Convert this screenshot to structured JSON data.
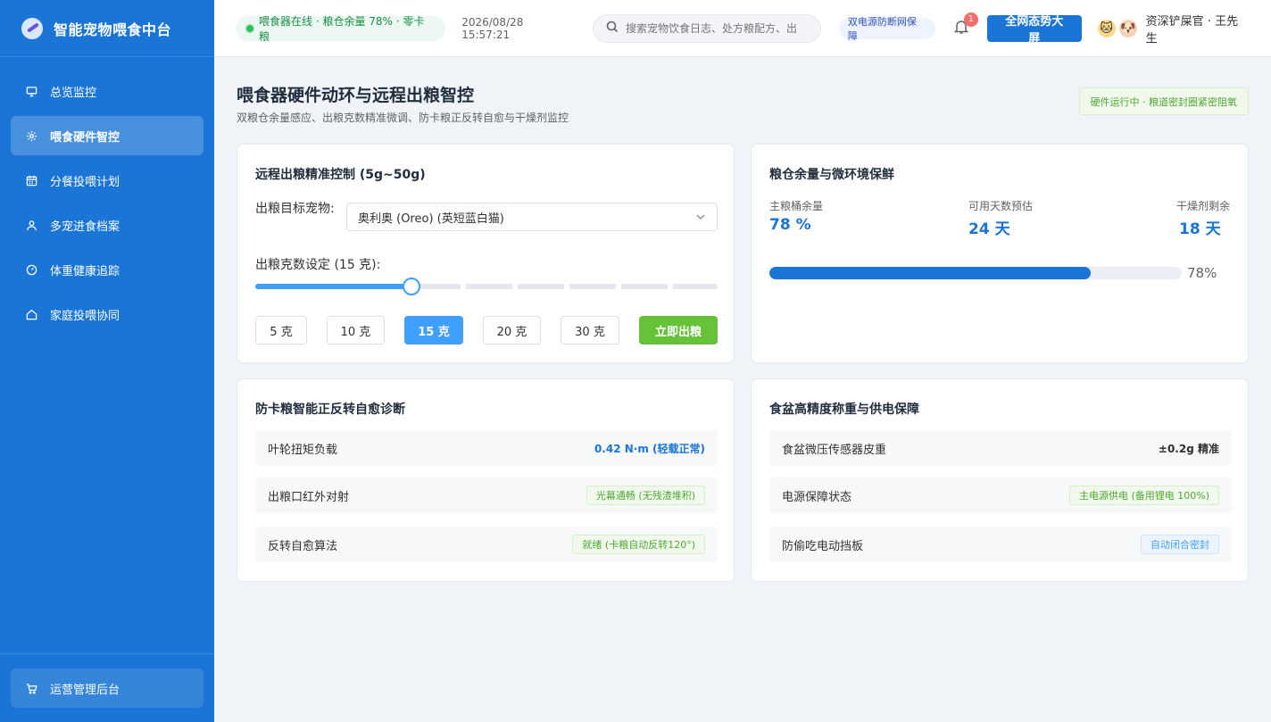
{
  "sidebar": {
    "brand": "智能宠物喂食中台",
    "items": [
      {
        "label": "总览监控",
        "icon": "monitor-icon"
      },
      {
        "label": "喂食硬件智控",
        "icon": "gear-icon",
        "active": true
      },
      {
        "label": "分餐投喂计划",
        "icon": "calendar-icon"
      },
      {
        "label": "多宠进食档案",
        "icon": "user-icon"
      },
      {
        "label": "体重健康追踪",
        "icon": "gauge-icon"
      },
      {
        "label": "家庭投喂协同",
        "icon": "home-icon"
      }
    ],
    "bottom_item": {
      "label": "运营管理后台",
      "icon": "cart-icon"
    }
  },
  "header": {
    "status": "喂食器在线 · 粮仓余量 78% · 零卡粮",
    "datetime": "2026/08/28 15:57:21",
    "search_placeholder": "搜索宠物饮食日志、处方粮配方、出",
    "power_tag": "双电源防断网保障",
    "notification_count": "1",
    "big_screen_button": "全网态势大屏",
    "user_name": "资深铲屎官 · 王先生",
    "avatar_cat": "🐱",
    "avatar_dog": "🐶"
  },
  "page": {
    "title": "喂食器硬件动环与远程出粮智控",
    "subtitle": "双粮仓余量感应、出粮克数精准微调、防卡粮正反转自愈与干燥剂监控",
    "run_tag": "硬件运行中 · 粮道密封圈紧密阻氧"
  },
  "dispense": {
    "title": "远程出粮精准控制 (5g~50g)",
    "pet_label": "出粮目标宠物:",
    "pet_selected": "奥利奥 (Oreo) (英短蓝白猫)",
    "gram_label": "出粮克数设定 (15 克):",
    "slider": {
      "min": 5,
      "max": 50,
      "value": 15
    },
    "presets": [
      "5 克",
      "10 克",
      "15 克",
      "20 克",
      "30 克"
    ],
    "active_preset": 2,
    "dispense_button": "立即出粮"
  },
  "storage": {
    "title": "粮仓余量与微环境保鲜",
    "stats": [
      {
        "label": "主粮桶余量",
        "value": "78 %"
      },
      {
        "label": "可用天数预估",
        "value": "24 天"
      },
      {
        "label": "干燥剂剩余",
        "value": "18 天"
      }
    ],
    "progress_percent": 78,
    "progress_text": "78%"
  },
  "anti_jam": {
    "title": "防卡粮智能正反转自愈诊断",
    "rows": [
      {
        "label": "叶轮扭矩负载",
        "value": "0.42 N·m (轻载正常)"
      },
      {
        "label": "出粮口红外对射",
        "value": "光幕通畅 (无残渣堆积)"
      },
      {
        "label": "反转自愈算法",
        "value": "就绪 (卡粮自动反转120°)"
      }
    ]
  },
  "bowl": {
    "title": "食盆高精度称重与供电保障",
    "rows": [
      {
        "label": "食盆微压传感器皮重",
        "value": "±0.2g 精准"
      },
      {
        "label": "电源保障状态",
        "value": "主电源供电 (备用锂电 100%)"
      },
      {
        "label": "防偷吃电动挡板",
        "value": "自动闭合密封"
      }
    ]
  },
  "colors": {
    "primary": "#1a75d6",
    "accent": "#409eff",
    "success": "#67c23a",
    "success_text": "#52a636"
  }
}
